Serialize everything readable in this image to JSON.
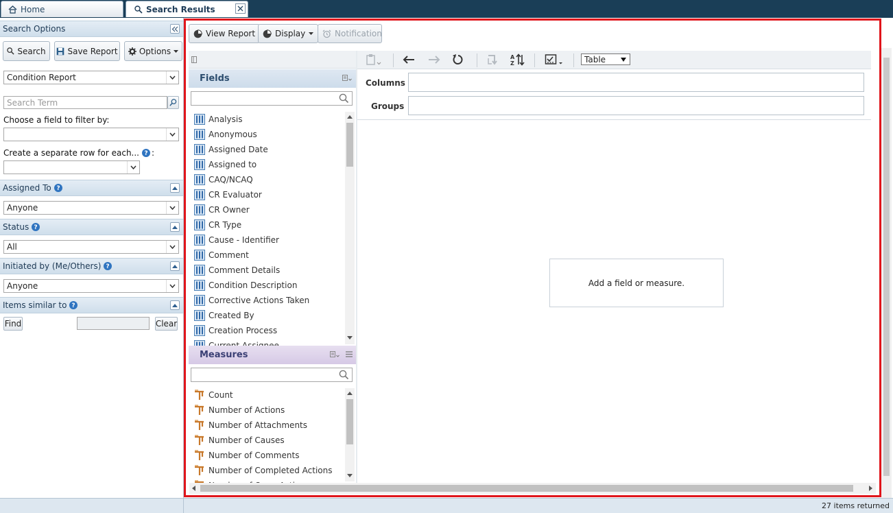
{
  "tabs": {
    "home": "Home",
    "search_results": "Search Results"
  },
  "search_options": {
    "title": "Search Options",
    "search_button": "Search",
    "save_report_button": "Save Report",
    "options_button": "Options",
    "report_type": "Condition Report",
    "search_term_placeholder": "Search Term",
    "filter_label": "Choose a field to filter by:",
    "filter_value": "",
    "separate_row_label": "Create a separate row for each...",
    "separate_row_value": ""
  },
  "sections": {
    "assigned_to": {
      "title": "Assigned To",
      "value": "Anyone"
    },
    "status": {
      "title": "Status",
      "value": "All"
    },
    "initiated_by": {
      "title": "Initiated by (Me/Others)",
      "value": "Anyone"
    },
    "items_similar": {
      "title": "Items similar to",
      "find_button": "Find",
      "clear_button": "Clear"
    }
  },
  "toolbar": {
    "view_report": "View Report",
    "display": "Display",
    "notification": "Notification"
  },
  "fields": {
    "title": "Fields",
    "items": [
      "Analysis",
      "Anonymous",
      "Assigned Date",
      "Assigned to",
      "CAQ/NCAQ",
      "CR Evaluator",
      "CR Owner",
      "CR Type",
      "Cause - Identifier",
      "Comment",
      "Comment Details",
      "Condition Description",
      "Corrective Actions Taken",
      "Created By",
      "Creation Process",
      "Current Assignee"
    ]
  },
  "measures": {
    "title": "Measures",
    "items": [
      "Count",
      "Number of Actions",
      "Number of Attachments",
      "Number of Causes",
      "Number of Comments",
      "Number of Completed Actions",
      "Number of Open Actions"
    ]
  },
  "pivot": {
    "view_type": "Table",
    "columns_label": "Columns",
    "groups_label": "Groups",
    "empty_message": "Add a field or measure."
  },
  "status_bar": {
    "items_returned": "27 items returned"
  },
  "colors": {
    "highlight": "#e0151b",
    "tabbar": "#1a3e57",
    "section_header": "#cfdeeb",
    "measures_header": "#d6c9e6"
  }
}
